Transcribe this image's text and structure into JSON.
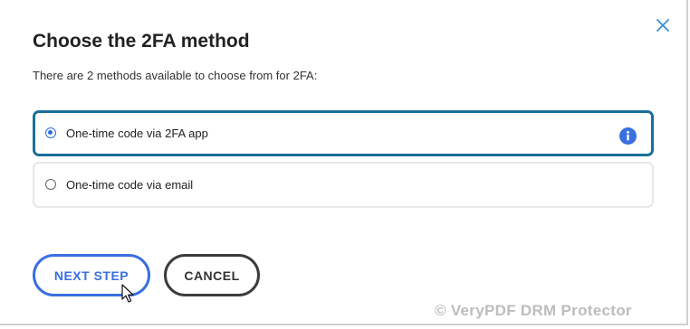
{
  "dialog": {
    "title": "Choose the 2FA method",
    "subtitle": "There are 2 methods available to choose from for 2FA:",
    "close_icon": "close-icon"
  },
  "options": [
    {
      "label": "One-time code via 2FA app",
      "selected": true,
      "icon": "info-icon"
    },
    {
      "label": "One-time code via email",
      "selected": false
    }
  ],
  "buttons": {
    "next_label": "NEXT STEP",
    "cancel_label": "CANCEL"
  },
  "watermark": "© VeryPDF DRM Protector",
  "colors": {
    "accent": "#3a6fe0",
    "selected_border": "#1a6f9a",
    "text": "#222222",
    "cancel_border": "#3c3c3c"
  }
}
